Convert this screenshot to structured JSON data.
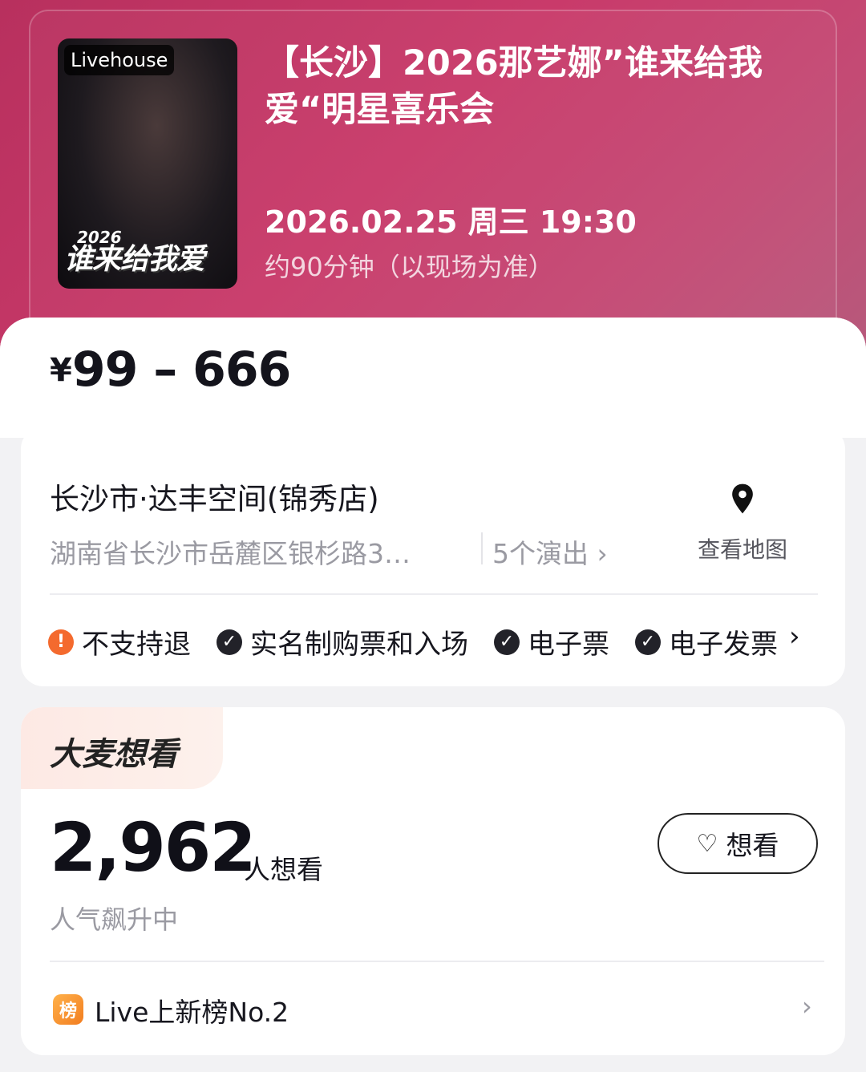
{
  "event": {
    "poster_badge": "Livehouse",
    "poster_title": "谁来给我爱",
    "poster_year": "2026",
    "title": "【长沙】2026那艺娜”谁来给我爱“明星喜乐会",
    "datetime": "2026.02.25 周三 19:30",
    "duration": "约90分钟（以现场为准）"
  },
  "price": {
    "currency": "¥",
    "range": "99 – 666"
  },
  "venue": {
    "name": "长沙市·达丰空间(锦秀店)",
    "address": "湖南省长沙市岳麓区银杉路3…",
    "shows": "5个演出 ›",
    "map_label": "查看地图",
    "tags": [
      {
        "label": "不支持退",
        "icon": "!",
        "kind": "warn"
      },
      {
        "label": "实名制购票和入场",
        "icon": "✓",
        "kind": "ok"
      },
      {
        "label": "电子票",
        "icon": "✓",
        "kind": "ok"
      },
      {
        "label": "电子发票",
        "icon": "✓",
        "kind": "ok"
      }
    ],
    "tags_arrow": "›"
  },
  "want": {
    "badge": "大麦想看",
    "count": "2,962",
    "unit": "人想看",
    "trend": "人气飙升中",
    "button_icon": "♡",
    "button_label": "想看"
  },
  "ranking": {
    "icon_char": "榜",
    "label": "Live上新榜No.2",
    "arrow": "›"
  },
  "colors": {
    "header": "#c93a6a",
    "warn": "#f46a2e",
    "rank": "#f27d20"
  }
}
